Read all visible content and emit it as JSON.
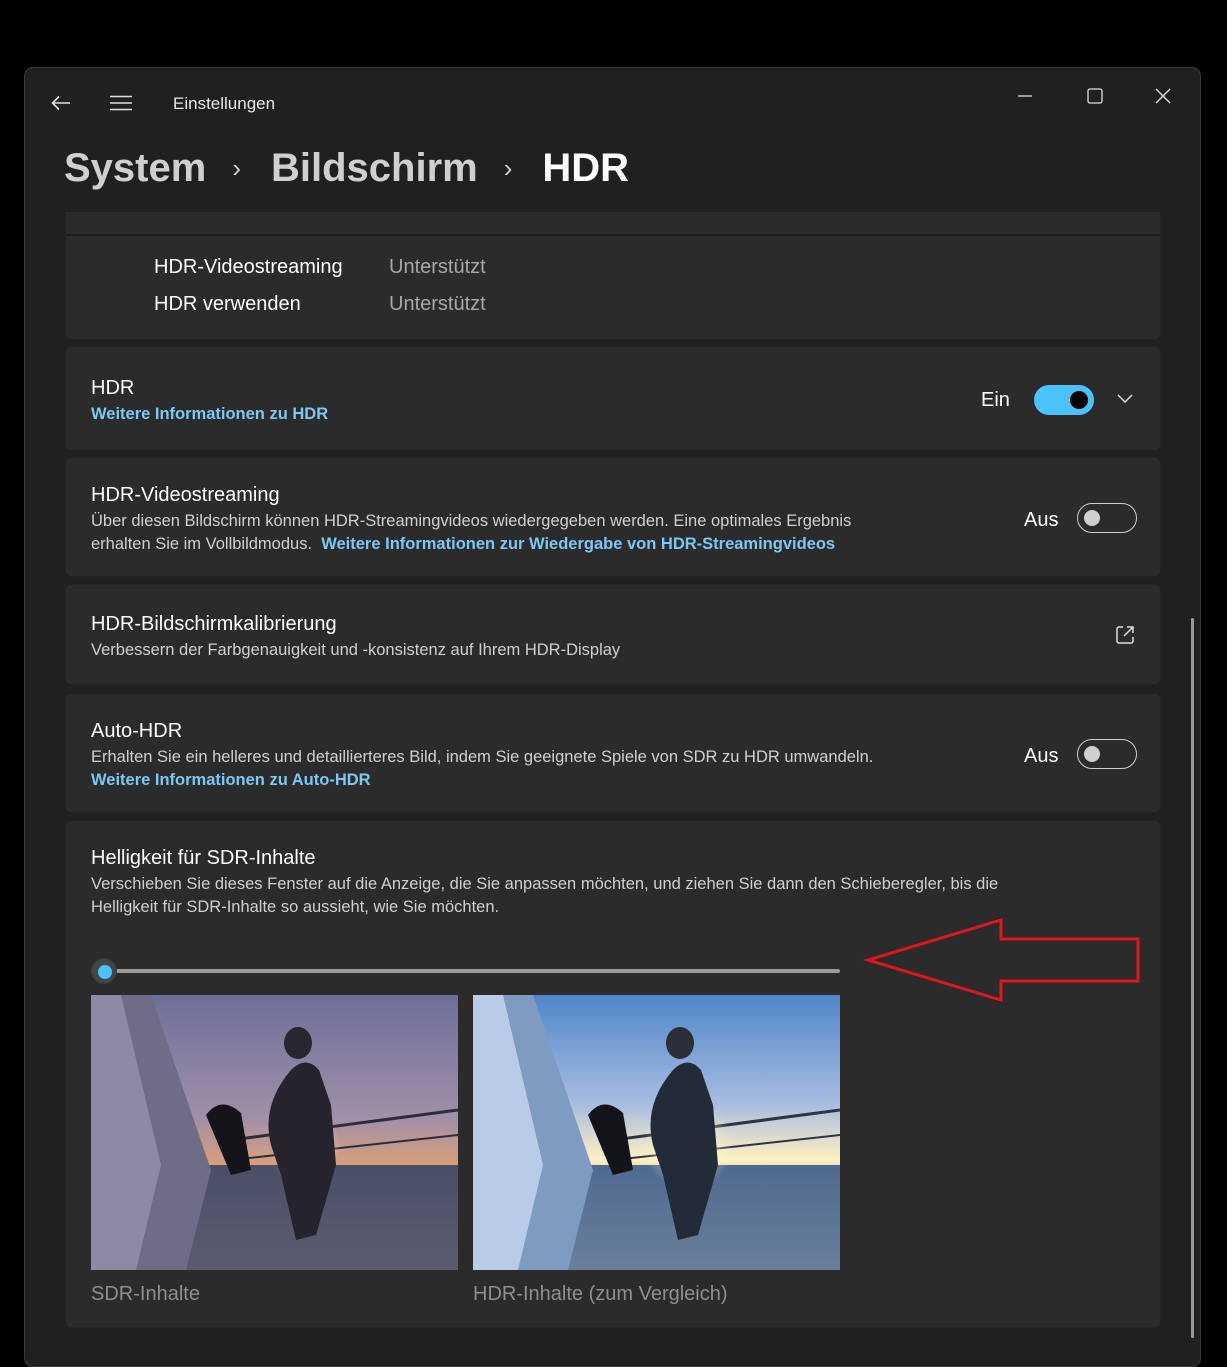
{
  "window": {
    "app_title": "Einstellungen",
    "back_icon": "arrow-left-icon",
    "menu_icon": "hamburger-menu-icon",
    "controls": [
      "minimize-icon",
      "maximize-icon",
      "close-icon"
    ]
  },
  "breadcrumb": {
    "items": [
      "System",
      "Bildschirm",
      "HDR"
    ],
    "separator": "›"
  },
  "capabilities": {
    "rows": [
      {
        "key": "HDR-Videostreaming",
        "value": "Unterstützt"
      },
      {
        "key": "HDR verwenden",
        "value": "Unterstützt"
      }
    ]
  },
  "hdr": {
    "title": "HDR",
    "link": "Weitere Informationen zu HDR",
    "state_label": "Ein",
    "enabled": true,
    "expand_icon": "chevron-down-icon"
  },
  "streaming": {
    "title": "HDR-Videostreaming",
    "desc_line1": "Über diesen Bildschirm können HDR-Streamingvideos wiedergegeben werden. Eine optimales Ergebnis",
    "desc_line2": "erhalten Sie im Vollbildmodus.",
    "link": "Weitere Informationen zur Wiedergabe von HDR-Streamingvideos",
    "state_label": "Aus",
    "enabled": false
  },
  "calibration": {
    "title": "HDR-Bildschirmkalibrierung",
    "desc": "Verbessern der Farbgenauigkeit und -konsistenz auf Ihrem HDR-Display",
    "icon": "open-external-icon"
  },
  "auto_hdr": {
    "title": "Auto-HDR",
    "desc": "Erhalten Sie ein helleres und detaillierteres Bild, indem Sie geeignete Spiele von SDR zu HDR umwandeln.",
    "link": "Weitere Informationen zu Auto-HDR",
    "state_label": "Aus",
    "enabled": false
  },
  "sdr_brightness": {
    "title": "Helligkeit für SDR-Inhalte",
    "desc_line1": "Verschieben Sie dieses Fenster auf die Anzeige, die Sie anpassen möchten, und ziehen Sie dann den Schieberegler, bis die",
    "desc_line2": "Helligkeit für SDR-Inhalte so aussieht, wie Sie möchten.",
    "slider_value": 0,
    "caption_sdr": "SDR-Inhalte",
    "caption_hdr": "HDR-Inhalte (zum Vergleich)",
    "annotation": "red-arrow-pointing-left"
  },
  "colors": {
    "accent": "#4cc2ff",
    "link": "#7cc8f5",
    "card_bg": "#2b2b2b",
    "window_bg": "#202020",
    "annotation_red": "#e0161f"
  }
}
